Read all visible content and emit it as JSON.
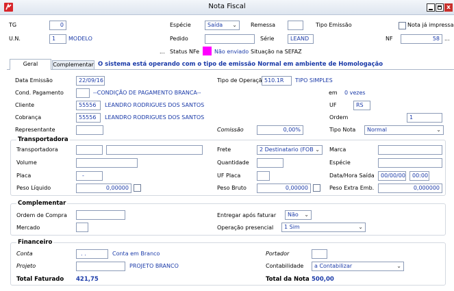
{
  "window": {
    "title": "Nota Fiscal",
    "app_icon": "app-logo-icon",
    "minimize_icon": "minimize-icon",
    "maximize_icon": "maximize-icon",
    "close_icon": "close-icon"
  },
  "header": {
    "tg_label": "TG",
    "tg_value": "0",
    "especie_label": "Espécie",
    "especie_value": "Saída",
    "remessa_label": "Remessa",
    "remessa_value": "",
    "tipo_emissao_label": "Tipo Emissão",
    "nota_ja_impressa_label": "Nota já impressa",
    "un_label": "U.N.",
    "un_value": "1",
    "un_name": "MODELO",
    "pedido_label": "Pedido",
    "pedido_value": "",
    "serie_label": "Série",
    "serie_value": "LEAND",
    "nf_label": "NF",
    "nf_value": "58",
    "nf_lookup": "...",
    "status_dots": "...",
    "status_nfe_label": "Status NFe",
    "status_nfe_value": "Não enviado",
    "status_color": "#ff00ff",
    "situacao_sefaz_label": "Situação na SEFAZ"
  },
  "tabs": [
    {
      "label": "Geral"
    },
    {
      "label": "Complementar"
    }
  ],
  "system_message": "O sistema está operando com o tipo de emissão Normal em ambiente de Homologação",
  "geral": {
    "data_emissao_label": "Data Emissão",
    "data_emissao_value": "22/09/16",
    "tipo_operacao_label": "Tipo de Operação",
    "tipo_operacao_code": "510.1R",
    "tipo_operacao_name": "TIPO SIMPLES",
    "cond_pagamento_label": "Cond. Pagamento",
    "cond_pagamento_value": "",
    "cond_pagamento_name": "--CONDIÇÃO DE PAGAMENTO BRANCA--",
    "em_label": "em",
    "vezes_value": "0 vezes",
    "cliente_label": "Cliente",
    "cliente_code": "55556",
    "cliente_name": "LEANDRO RODRIGUES DOS SANTOS",
    "uf_label": "UF",
    "uf_value": "RS",
    "cobranca_label": "Cobrança",
    "cobranca_code": "55556",
    "cobranca_name": "LEANDRO RODRIGUES DOS SANTOS",
    "ordem_label": "Ordem",
    "ordem_value": "1",
    "representante_label": "Representante",
    "representante_value": "",
    "comissao_label": "Comissão",
    "comissao_value": "0,00%",
    "tipo_nota_label": "Tipo Nota",
    "tipo_nota_value": "Normal"
  },
  "transportadora": {
    "group_title": "Transportadora",
    "transportadora_label": "Transportadora",
    "transportadora_code": "",
    "transportadora_name": "",
    "frete_label": "Frete",
    "frete_value": "2 Destinatario (FOB)",
    "marca_label": "Marca",
    "marca_value": "",
    "volume_label": "Volume",
    "volume_value": "",
    "quantidade_label": "Quantidade",
    "quantidade_value": "",
    "especie_label": "Espécie",
    "especie_value": "",
    "placa_label": "Placa",
    "placa_value": "-",
    "uf_placa_label": "UF Placa",
    "uf_placa_value": "",
    "data_hora_saida_label": "Data/Hora Saída",
    "data_saida_value": "00/00/00",
    "hora_saida_value": "00:00",
    "peso_liquido_label": "Peso Líquido",
    "peso_liquido_value": "0,00000",
    "peso_bruto_label": "Peso Bruto",
    "peso_bruto_value": "0,00000",
    "peso_extra_label": "Peso Extra Emb.",
    "peso_extra_value": "0,000000"
  },
  "complementar": {
    "group_title": "Complementar",
    "ordem_compra_label": "Ordem de Compra",
    "ordem_compra_value": "",
    "entregar_apos_label": "Entregar após faturar",
    "entregar_apos_value": "Não",
    "mercado_label": "Mercado",
    "mercado_value": "",
    "operacao_presencial_label": "Operação presencial",
    "operacao_presencial_value": "1 Sim"
  },
  "financeiro": {
    "group_title": "Financeiro",
    "conta_label": "Conta",
    "conta_value": ". .",
    "conta_name": "Conta em Branco",
    "portador_label": "Portador",
    "portador_value": "",
    "projeto_label": "Projeto",
    "projeto_value": "",
    "projeto_name": "PROJETO BRANCO",
    "contabilidade_label": "Contabilidade",
    "contabilidade_value": "a Contabilizar",
    "total_faturado_label": "Total Faturado",
    "total_faturado_value": "421,75",
    "total_nota_label": "Total da Nota",
    "total_nota_value": "500,00"
  }
}
